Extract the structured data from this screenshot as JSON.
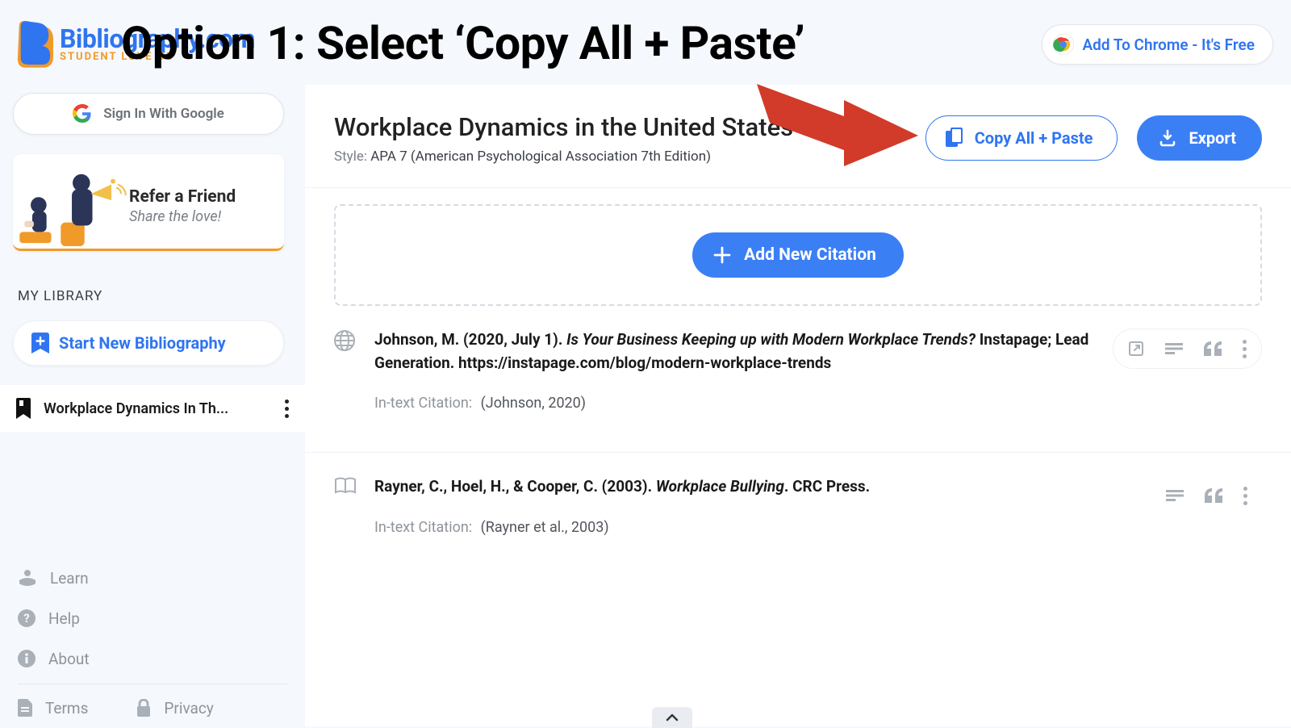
{
  "overlay": {
    "title": "Option 1: Select ‘Copy All + Paste’"
  },
  "brand": {
    "name": "Bibliography.com",
    "tagline": "STUDENT LOVE US"
  },
  "chromePill": {
    "label": "Add To Chrome - It's Free"
  },
  "sidebar": {
    "signIn": "Sign In With Google",
    "refer": {
      "title": "Refer a Friend",
      "sub": "Share the love!"
    },
    "libraryLabel": "MY LIBRARY",
    "startNew": "Start New Bibliography",
    "activeBib": "Workplace Dynamics In Th...",
    "links": {
      "learn": "Learn",
      "help": "Help",
      "about": "About",
      "terms": "Terms",
      "privacy": "Privacy"
    }
  },
  "main": {
    "title": "Workplace Dynamics in the United States",
    "styleLabel": "Style:",
    "styleValue": "APA 7 (American Psychological Association 7th Edition)",
    "copyAll": "Copy All + Paste",
    "export": "Export",
    "addNew": "Add New Citation",
    "citations": [
      {
        "type": "web",
        "prefix": "Johnson, M. (2020, July 1). ",
        "italic": "Is Your Business Keeping up with Modern Workplace Trends?",
        "suffix": " Instapage; Lead Generation. https://instapage.com/blog/modern-workplace-trends",
        "intextLabel": "In-text Citation:",
        "intext": "(Johnson, 2020)",
        "hasOpen": true
      },
      {
        "type": "book",
        "prefix": "Rayner, C., Hoel, H., & Cooper, C. (2003). ",
        "italic": "Workplace Bullying",
        "suffix": ". CRC Press.",
        "intextLabel": "In-text Citation:",
        "intext": "(Rayner et al., 2003)",
        "hasOpen": false
      }
    ]
  }
}
